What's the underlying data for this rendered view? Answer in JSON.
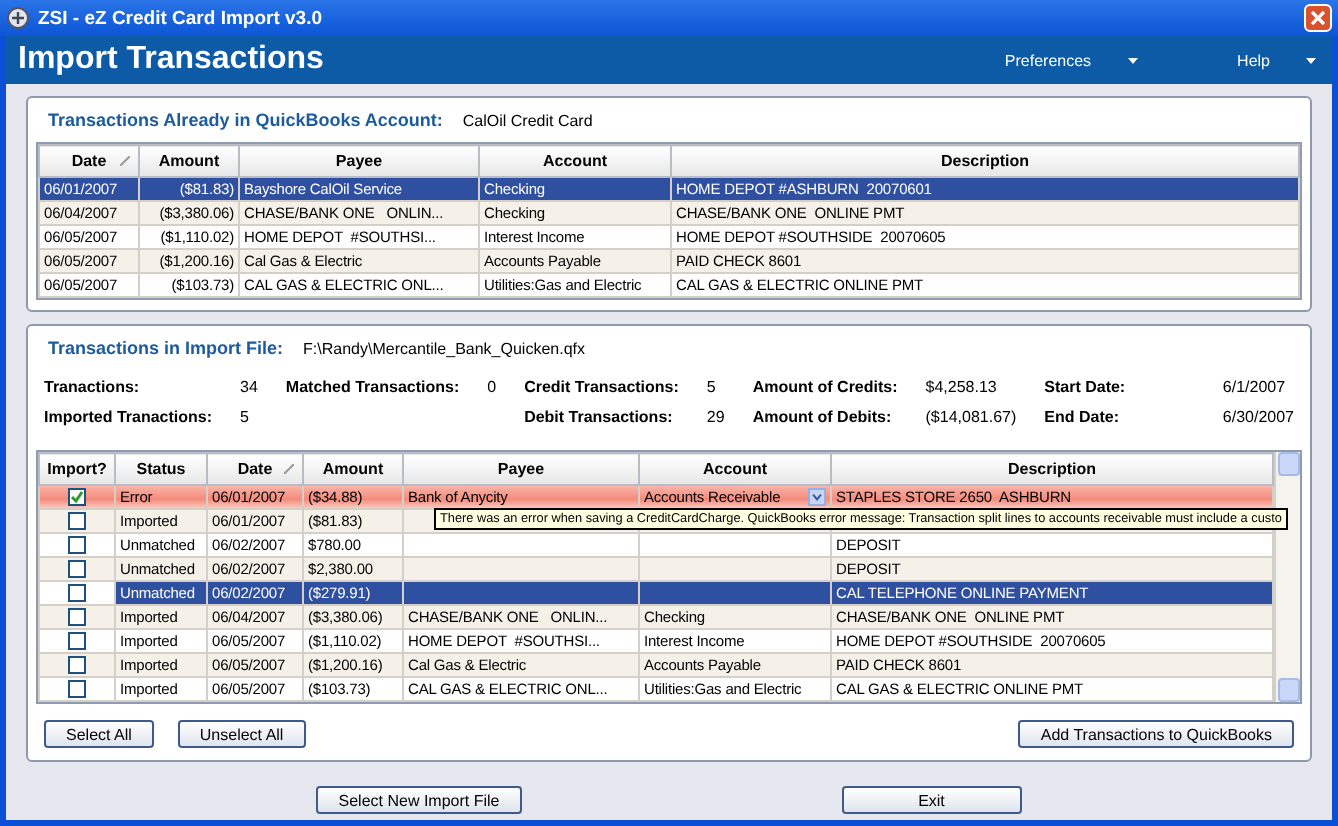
{
  "window": {
    "title": "ZSI - eZ Credit Card Import v3.0"
  },
  "header": {
    "title": "Import Transactions",
    "menus": [
      "Preferences",
      "Help"
    ]
  },
  "existing": {
    "heading": "Transactions Already in QuickBooks Account:",
    "account": "CalOil Credit Card",
    "columns": [
      "Date",
      "Amount",
      "Payee",
      "Account",
      "Description"
    ],
    "rows": [
      {
        "selected": true,
        "cells": [
          "06/01/2007",
          "($81.83)",
          "Bayshore CalOil Service",
          "Checking",
          "HOME DEPOT #ASHBURN  20070601"
        ]
      },
      {
        "selected": false,
        "cells": [
          "06/04/2007",
          "($3,380.06)",
          "CHASE/BANK ONE   ONLIN...",
          "Checking",
          "CHASE/BANK ONE  ONLINE PMT"
        ]
      },
      {
        "selected": false,
        "cells": [
          "06/05/2007",
          "($1,110.02)",
          "HOME DEPOT  #SOUTHSI...",
          "Interest Income",
          "HOME DEPOT #SOUTHSIDE  20070605"
        ]
      },
      {
        "selected": false,
        "cells": [
          "06/05/2007",
          "($1,200.16)",
          "Cal Gas & Electric",
          "Accounts Payable",
          "PAID CHECK 8601"
        ]
      },
      {
        "selected": false,
        "cells": [
          "06/05/2007",
          "($103.73)",
          "CAL GAS & ELECTRIC ONL...",
          "Utilities:Gas and Electric",
          "CAL GAS & ELECTRIC ONLINE PMT"
        ]
      }
    ]
  },
  "import": {
    "heading": "Transactions in Import File:",
    "file": "F:\\Randy\\Mercantile_Bank_Quicken.qfx",
    "stats": [
      [
        {
          "label": "Tranactions:",
          "value": "34"
        },
        {
          "label": "Imported Tranactions:",
          "value": "5"
        }
      ],
      [
        {
          "label": "Matched Transactions:",
          "value": "0"
        }
      ],
      [
        {
          "label": "Credit Transactions:",
          "value": "5"
        },
        {
          "label": "Debit Transactions:",
          "value": "29"
        }
      ],
      [
        {
          "label": "Amount of Credits:",
          "value": "$4,258.13"
        },
        {
          "label": "Amount of Debits:",
          "value": "($14,081.67)"
        }
      ],
      [
        {
          "label": "Start Date:",
          "value": "6/1/2007"
        },
        {
          "label": "End Date:",
          "value": "6/30/2007"
        }
      ]
    ],
    "columns": [
      "Import?",
      "Status",
      "Date",
      "Amount",
      "Payee",
      "Account",
      "Description"
    ],
    "rows": [
      {
        "checked": true,
        "selected": false,
        "error": true,
        "cells": [
          "",
          "Error",
          "06/01/2007",
          "($34.88)",
          "Bank of Anycity",
          "Accounts Receivable",
          "STAPLES STORE 2650  ASHBURN"
        ]
      },
      {
        "checked": false,
        "selected": false,
        "error": false,
        "cells": [
          "",
          "Imported",
          "06/01/2007",
          "($81.83)",
          "",
          "",
          ""
        ]
      },
      {
        "checked": false,
        "selected": false,
        "error": false,
        "cells": [
          "",
          "Unmatched",
          "06/02/2007",
          "$780.00",
          "",
          "",
          "DEPOSIT"
        ]
      },
      {
        "checked": false,
        "selected": false,
        "error": false,
        "cells": [
          "",
          "Unmatched",
          "06/02/2007",
          "$2,380.00",
          "",
          "",
          "DEPOSIT"
        ]
      },
      {
        "checked": false,
        "selected": true,
        "error": false,
        "cells": [
          "",
          "Unmatched",
          "06/02/2007",
          "($279.91)",
          "",
          "",
          "CAL TELEPHONE ONLINE PAYMENT"
        ]
      },
      {
        "checked": false,
        "selected": false,
        "error": false,
        "cells": [
          "",
          "Imported",
          "06/04/2007",
          "($3,380.06)",
          "CHASE/BANK ONE   ONLIN...",
          "Checking",
          "CHASE/BANK ONE  ONLINE PMT"
        ]
      },
      {
        "checked": false,
        "selected": false,
        "error": false,
        "cells": [
          "",
          "Imported",
          "06/05/2007",
          "($1,110.02)",
          "HOME DEPOT  #SOUTHSI...",
          "Interest Income",
          "HOME DEPOT #SOUTHSIDE  20070605"
        ]
      },
      {
        "checked": false,
        "selected": false,
        "error": false,
        "cells": [
          "",
          "Imported",
          "06/05/2007",
          "($1,200.16)",
          "Cal Gas & Electric",
          "Accounts Payable",
          "PAID CHECK 8601"
        ]
      },
      {
        "checked": false,
        "selected": false,
        "error": false,
        "cells": [
          "",
          "Imported",
          "06/05/2007",
          "($103.73)",
          "CAL GAS & ELECTRIC ONL...",
          "Utilities:Gas and Electric",
          "CAL GAS & ELECTRIC ONLINE PMT"
        ]
      }
    ],
    "tooltip": "There was an error when saving a CreditCardCharge.  QuickBooks error message: Transaction split lines to accounts receivable must include a custo",
    "buttons": [
      "Select All",
      "Unselect All"
    ],
    "primary_button": "Add Transactions to QuickBooks"
  },
  "footer_buttons": [
    "Select New Import File",
    "Exit"
  ]
}
